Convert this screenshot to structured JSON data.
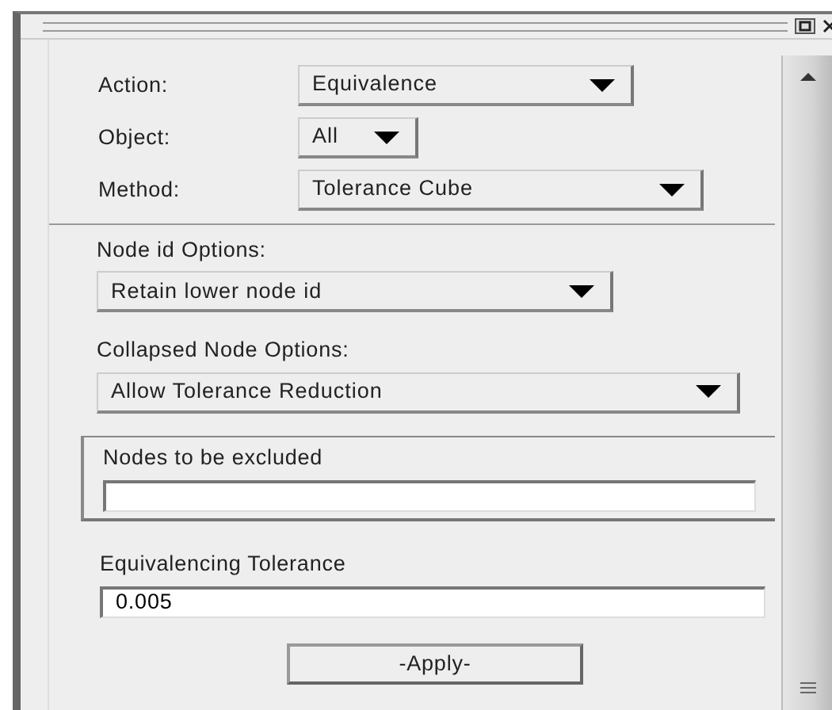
{
  "top_selectors": [
    {
      "label": "Action:",
      "value": "Equivalence"
    },
    {
      "label": "Object:",
      "value": "All"
    },
    {
      "label": "Method:",
      "value": "Tolerance Cube"
    }
  ],
  "option_groups": [
    {
      "label": "Node id Options:",
      "value": "Retain lower node id"
    },
    {
      "label": "Collapsed Node Options:",
      "value": "Allow Tolerance Reduction"
    }
  ],
  "excluded_nodes": {
    "label": "Nodes to be excluded"
  },
  "tolerance": {
    "label": "Equivalencing Tolerance",
    "value": "0.005"
  },
  "apply_button": {
    "label": "-Apply-"
  }
}
